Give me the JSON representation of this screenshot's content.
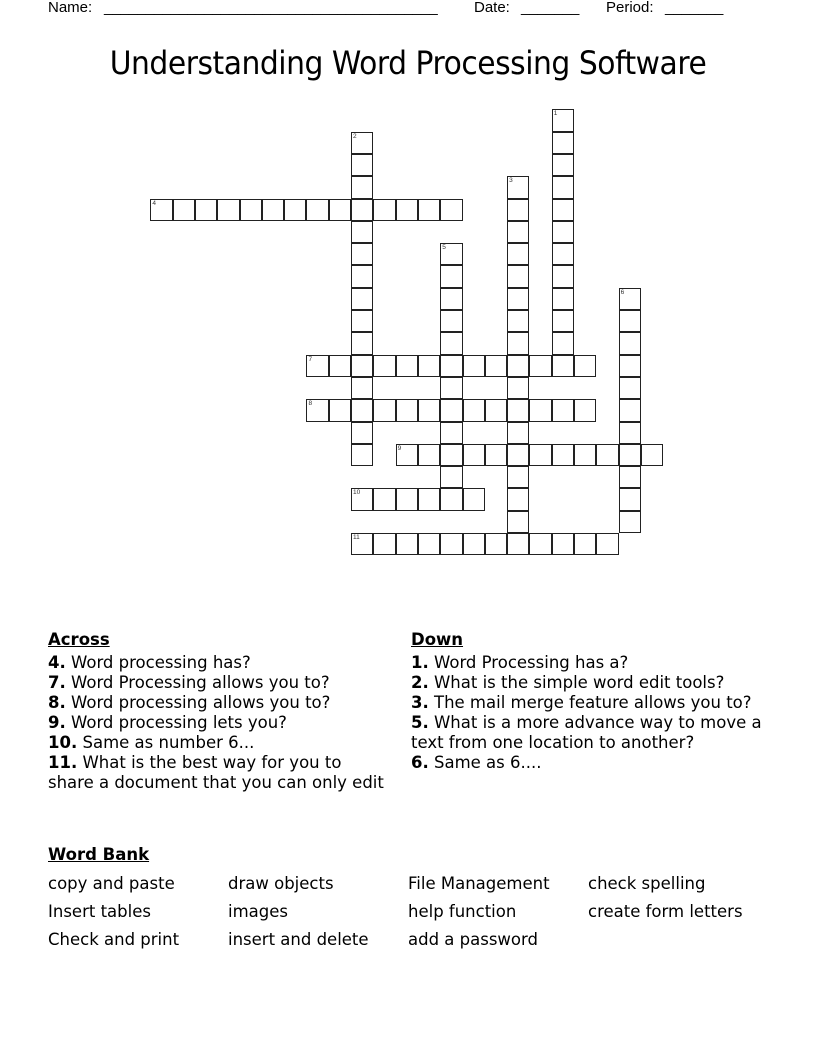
{
  "header": {
    "name_label": "Name:",
    "name_line": "________________________________________",
    "date_label": "Date:",
    "date_line": "_______",
    "period_label": "Period:",
    "period_line": "_______"
  },
  "title": "Understanding Word Processing Software",
  "puzzle": {
    "words": [
      {
        "num": "1",
        "dir": "down",
        "row": 0,
        "col": 18,
        "length": 12
      },
      {
        "num": "2",
        "dir": "down",
        "row": 1,
        "col": 9,
        "length": 15
      },
      {
        "num": "3",
        "dir": "down",
        "row": 3,
        "col": 16,
        "length": 17
      },
      {
        "num": "4",
        "dir": "across",
        "row": 4,
        "col": 0,
        "length": 14
      },
      {
        "num": "5",
        "dir": "down",
        "row": 6,
        "col": 13,
        "length": 12
      },
      {
        "num": "6",
        "dir": "down",
        "row": 8,
        "col": 21,
        "length": 11
      },
      {
        "num": "7",
        "dir": "across",
        "row": 11,
        "col": 7,
        "length": 13
      },
      {
        "num": "8",
        "dir": "across",
        "row": 13,
        "col": 7,
        "length": 13
      },
      {
        "num": "9",
        "dir": "across",
        "row": 15,
        "col": 11,
        "length": 12
      },
      {
        "num": "10",
        "dir": "across",
        "row": 17,
        "col": 9,
        "length": 6
      },
      {
        "num": "11",
        "dir": "across",
        "row": 19,
        "col": 9,
        "length": 12
      }
    ]
  },
  "across": {
    "heading": "Across",
    "clues": [
      {
        "num": "4.",
        "text": " Word processing has?"
      },
      {
        "num": "7.",
        "text": " Word Processing allows you to?"
      },
      {
        "num": "8.",
        "text": " Word processing allows you to?"
      },
      {
        "num": "9.",
        "text": " Word processing lets you?"
      },
      {
        "num": "10.",
        "text": " Same as number 6..."
      },
      {
        "num": "11.",
        "text": " What is the best way for you to share a document that you can only edit"
      }
    ]
  },
  "down": {
    "heading": "Down",
    "clues": [
      {
        "num": "1.",
        "text": " Word Processing has a?"
      },
      {
        "num": "2.",
        "text": " What is the simple word edit tools?"
      },
      {
        "num": "3.",
        "text": " The mail merge feature allows you to?"
      },
      {
        "num": "5.",
        "text": " What is a more advance way to move a text from one location to another?"
      },
      {
        "num": "6.",
        "text": " Same as 6...."
      }
    ]
  },
  "word_bank": {
    "heading": "Word Bank",
    "columns": [
      [
        "copy and paste",
        "Insert tables",
        "Check and print"
      ],
      [
        "draw objects",
        "images",
        "insert and delete"
      ],
      [
        "File Management",
        "help function",
        "add a password"
      ],
      [
        "check spelling",
        "create form letters"
      ]
    ]
  }
}
